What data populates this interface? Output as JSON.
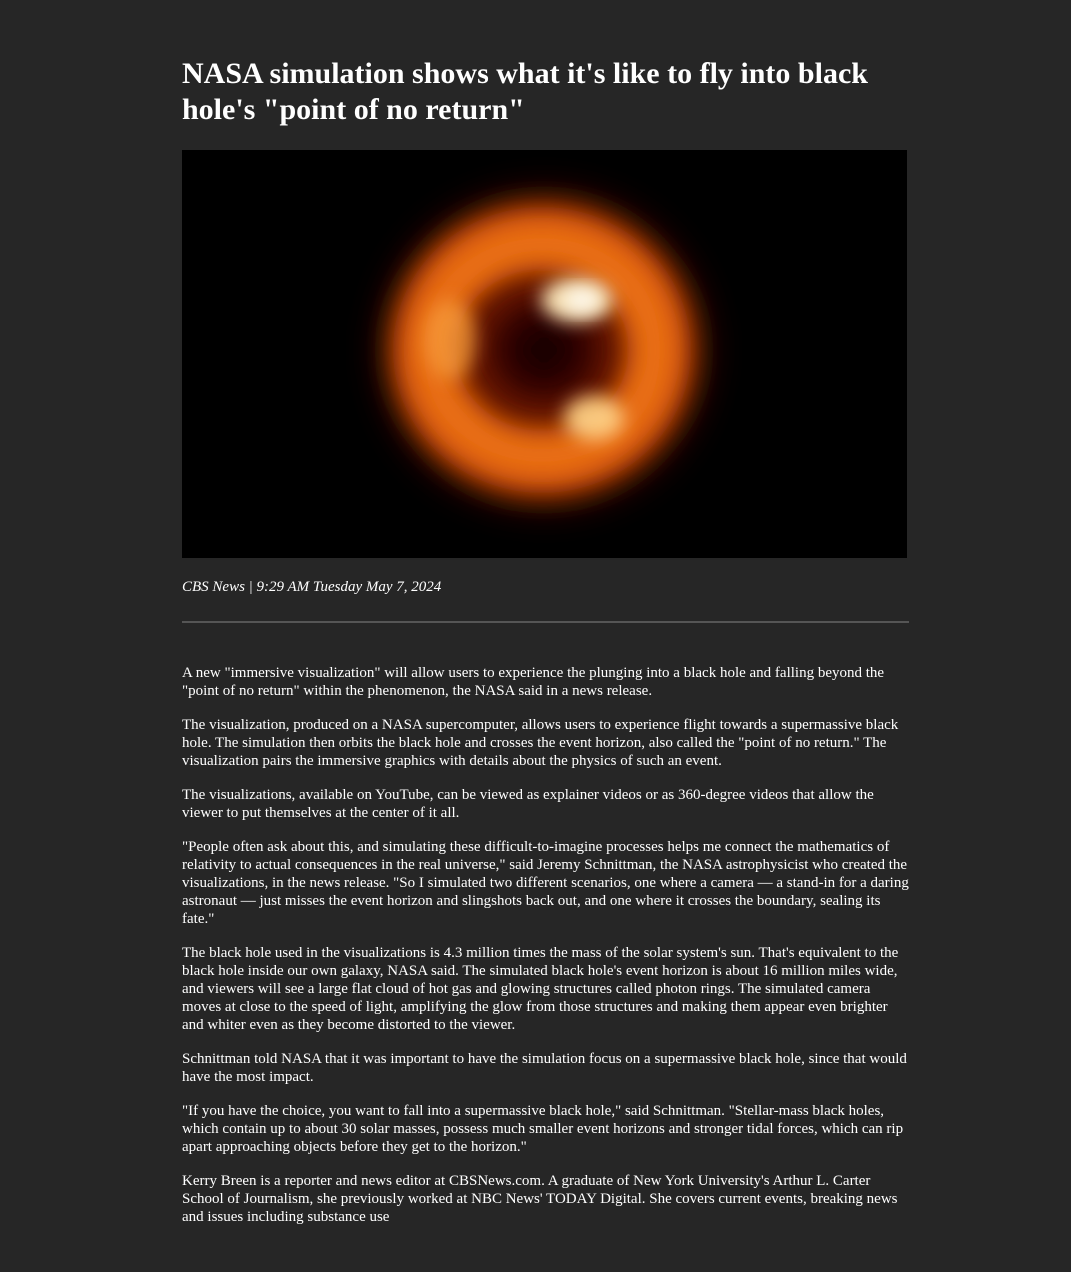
{
  "article": {
    "headline": "NASA simulation shows what it's like to fly into black hole's \"point of no return\"",
    "image_alt": "Black hole image",
    "byline": "CBS News | 9:29 AM Tuesday May 7, 2024",
    "paragraphs": [
      "A new \"immersive visualization\" will allow users to experience the plunging into a black hole and falling beyond the \"point of no return\" within the phenomenon, the NASA said in a news release.",
      "The visualization, produced on a NASA supercomputer, allows users to experience flight towards a supermassive black hole. The simulation then orbits the black hole and crosses the event horizon, also called the \"point of no return.\" The visualization pairs the immersive graphics with details about the physics of such an event.",
      "The visualizations, available on YouTube, can be viewed as explainer videos or as 360-degree videos that allow the viewer to put themselves at the center of it all.",
      "\"People often ask about this, and simulating these difficult-to-imagine processes helps me connect the mathematics of relativity to actual consequences in the real universe,\" said Jeremy Schnittman, the NASA astrophysicist who created the visualizations, in the news release. \"So I simulated two different scenarios, one where a camera — a stand-in for a daring astronaut — just misses the event horizon and slingshots back out, and one where it crosses the boundary, sealing its fate.\"",
      "The black hole used in the visualizations is 4.3 million times the mass of the solar system's sun. That's equivalent to the black hole inside our own galaxy, NASA said. The simulated black hole's event horizon is about 16 million miles wide, and viewers will see a large flat cloud of hot gas and glowing structures called photon rings. The simulated camera moves at close to the speed of light, amplifying the glow from those structures and making them appear even brighter and whiter even as they become distorted to the viewer.",
      "Schnittman told NASA that it was important to have the simulation focus on a supermassive black hole, since that would have the most impact.",
      "\"If you have the choice, you want to fall into a supermassive black hole,\" said Schnittman. \"Stellar-mass black holes, which contain up to about 30 solar masses, possess much smaller event horizons and stronger tidal forces, which can rip apart approaching objects before they get to the horizon.\"",
      "Kerry Breen is a reporter and news editor at CBSNews.com. A graduate of New York University's Arthur L. Carter School of Journalism, she previously worked at NBC News' TODAY Digital. She covers current events, breaking news and issues including substance use"
    ]
  },
  "colors": {
    "page_background": "#262626",
    "text": "#ffffff",
    "divider": "#555555",
    "image_background": "#000000",
    "glow_outer": "#a82a00",
    "glow_mid": "#f07010",
    "glow_bright": "#fff0c8"
  }
}
